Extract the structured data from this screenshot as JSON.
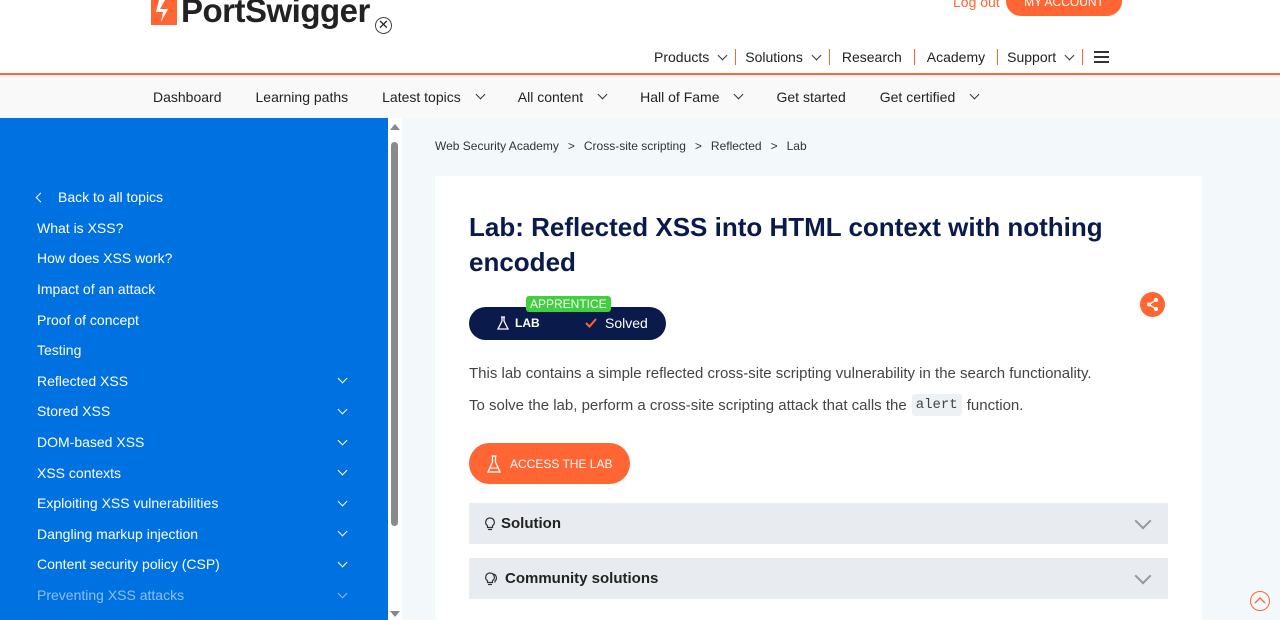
{
  "header": {
    "logo_text": "PortSwigger",
    "logout": "Log out",
    "my_account": "MY ACCOUNT",
    "nav": [
      {
        "label": "Products",
        "dropdown": true
      },
      {
        "label": "Solutions",
        "dropdown": true
      },
      {
        "label": "Research",
        "dropdown": false
      },
      {
        "label": "Academy",
        "dropdown": false
      },
      {
        "label": "Support",
        "dropdown": true
      }
    ],
    "accent_color": "#ff6633"
  },
  "subnav": [
    {
      "label": "Dashboard",
      "dropdown": false
    },
    {
      "label": "Learning paths",
      "dropdown": false
    },
    {
      "label": "Latest topics",
      "dropdown": true
    },
    {
      "label": "All content",
      "dropdown": true
    },
    {
      "label": "Hall of Fame",
      "dropdown": true
    },
    {
      "label": "Get started",
      "dropdown": false
    },
    {
      "label": "Get certified",
      "dropdown": true
    }
  ],
  "sidebar": {
    "close_symbol": "✕",
    "back": "Back to all topics",
    "items": [
      {
        "label": "What is XSS?",
        "expand": false
      },
      {
        "label": "How does XSS work?",
        "expand": false
      },
      {
        "label": "Impact of an attack",
        "expand": false
      },
      {
        "label": "Proof of concept",
        "expand": false
      },
      {
        "label": "Testing",
        "expand": false
      },
      {
        "label": "Reflected XSS",
        "expand": true
      },
      {
        "label": "Stored XSS",
        "expand": true
      },
      {
        "label": "DOM-based XSS",
        "expand": true
      },
      {
        "label": "XSS contexts",
        "expand": true
      },
      {
        "label": "Exploiting XSS vulnerabilities",
        "expand": true
      },
      {
        "label": "Dangling markup injection",
        "expand": true
      },
      {
        "label": "Content security policy (CSP)",
        "expand": true
      },
      {
        "label": "Preventing XSS attacks",
        "expand": true
      }
    ],
    "bg_color": "#0071e0"
  },
  "breadcrumb": [
    "Web Security Academy",
    "Cross-site scripting",
    "Reflected",
    "Lab"
  ],
  "breadcrumb_sep": ">",
  "lab": {
    "title": "Lab: Reflected XSS into HTML context with nothing encoded",
    "level": "APPRENTICE",
    "tag": "LAB",
    "status": "Solved",
    "description": "This lab contains a simple reflected cross-site scripting vulnerability in the search functionality.",
    "task_before": "To solve the lab, perform a cross-site scripting attack that calls the",
    "task_code": "alert",
    "task_after": "function.",
    "access_button": "ACCESS THE LAB",
    "accordions": [
      "Solution",
      "Community solutions"
    ]
  }
}
